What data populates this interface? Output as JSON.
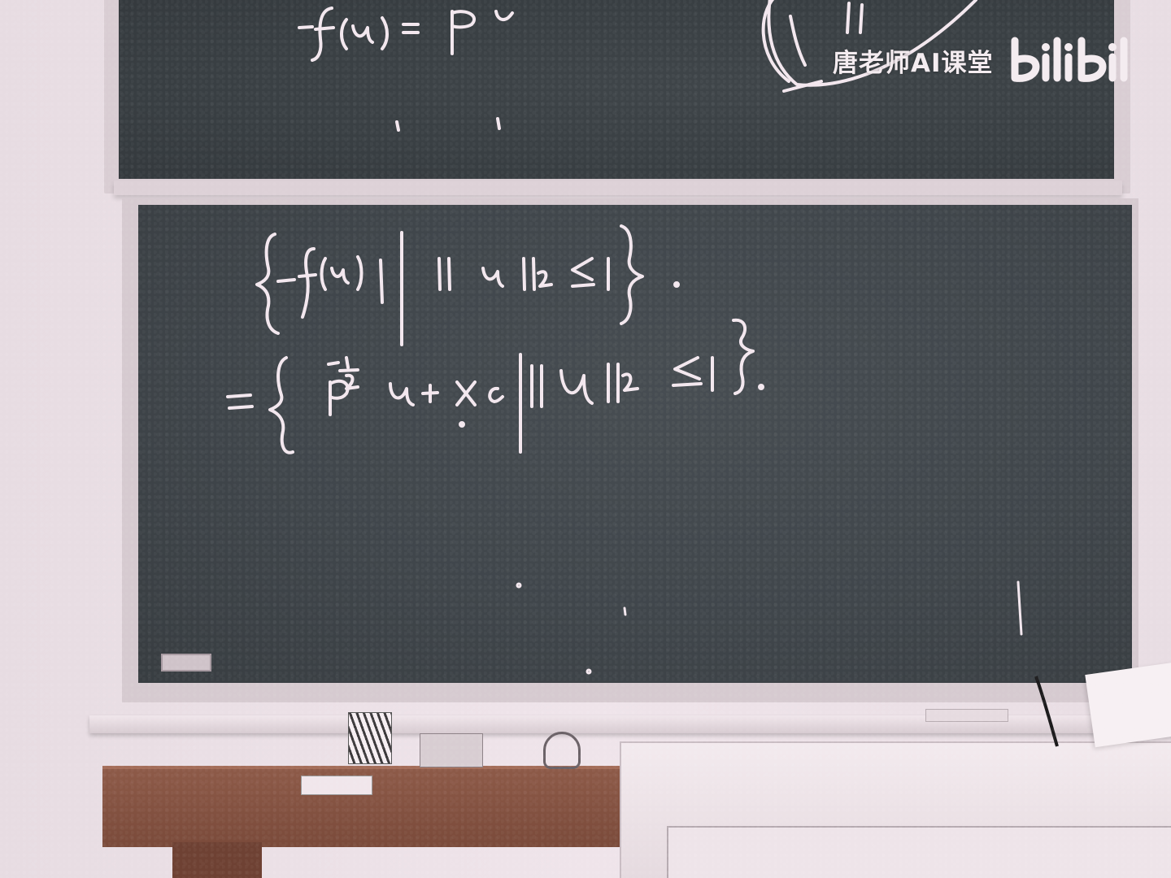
{
  "watermark": {
    "channel_name": "唐老师AI课堂",
    "logo_text": "bilibili",
    "color": "#f4ecf0"
  },
  "board": {
    "color": "#41474c",
    "chalk_color": "#f3e7ee",
    "frame_color": "#d6cad0"
  },
  "desk": {
    "wood_color": "#7a4a3a",
    "podium_color": "#eee4e9"
  }
}
